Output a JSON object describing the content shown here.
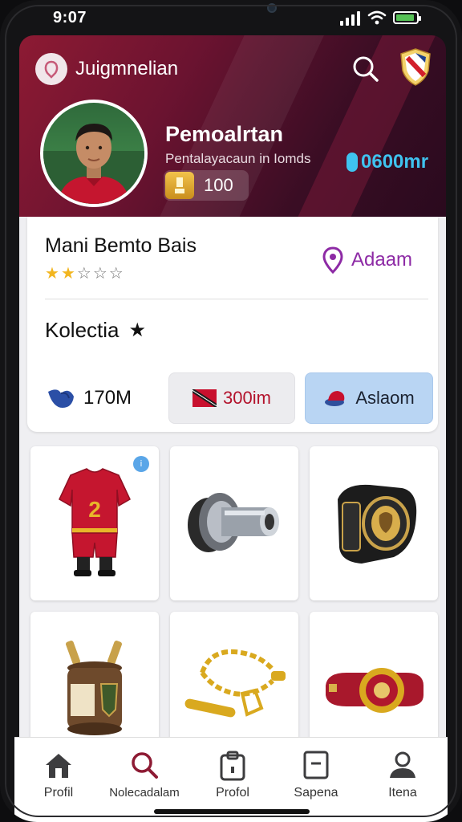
{
  "status_bar": {
    "time": "9:07"
  },
  "header": {
    "app_name": "Juigmnelian",
    "player_name": "Pemoalrtan",
    "player_subtitle": "Pentalayacaun in Iomds",
    "level": "100",
    "coins": "0600mr"
  },
  "club_card": {
    "club_name": "Mani Bemto Bais",
    "rating": 2,
    "rating_max": 5,
    "location": "Adaam",
    "collection_title": "Kolectia",
    "stat_value": "170M",
    "value_button": "300im",
    "action_button": "Aslaom"
  },
  "collection_items": [
    {
      "icon": "jersey-icon",
      "badge": "i"
    },
    {
      "icon": "engine-part-icon"
    },
    {
      "icon": "bracelet-icon"
    },
    {
      "icon": "urn-icon"
    },
    {
      "icon": "chain-icon"
    },
    {
      "icon": "wristband-icon"
    }
  ],
  "bottom_nav": [
    {
      "label": "Profil",
      "icon": "home-icon"
    },
    {
      "label": "Nolecadalam",
      "icon": "search-icon"
    },
    {
      "label": "Profol",
      "icon": "bag-icon"
    },
    {
      "label": "Sapena",
      "icon": "document-icon"
    },
    {
      "label": "Itena",
      "icon": "user-icon"
    }
  ],
  "colors": {
    "header_primary": "#8d1a33",
    "header_dark": "#2a0a1e",
    "coins_accent": "#3fc3ef",
    "location_accent": "#8d2aa5",
    "value_text": "#b3132c",
    "action_bg": "#b9d5f3"
  }
}
